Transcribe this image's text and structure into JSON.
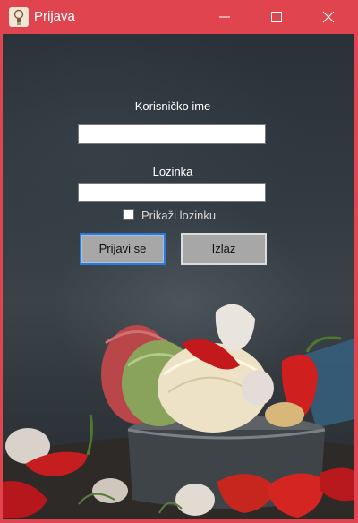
{
  "window": {
    "title": "Prijava",
    "icon": "lightbulb-app-icon",
    "controls": {
      "minimize": "minimize-icon",
      "maximize": "maximize-icon",
      "close": "close-icon"
    },
    "accent_color": "#e0454f"
  },
  "form": {
    "username_label": "Korisničko ime",
    "username_value": "",
    "password_label": "Lozinka",
    "password_value": "",
    "show_password_label": "Prikaži lozinku",
    "show_password_checked": false,
    "login_button": "Prijavi se",
    "exit_button": "Izlaz"
  }
}
